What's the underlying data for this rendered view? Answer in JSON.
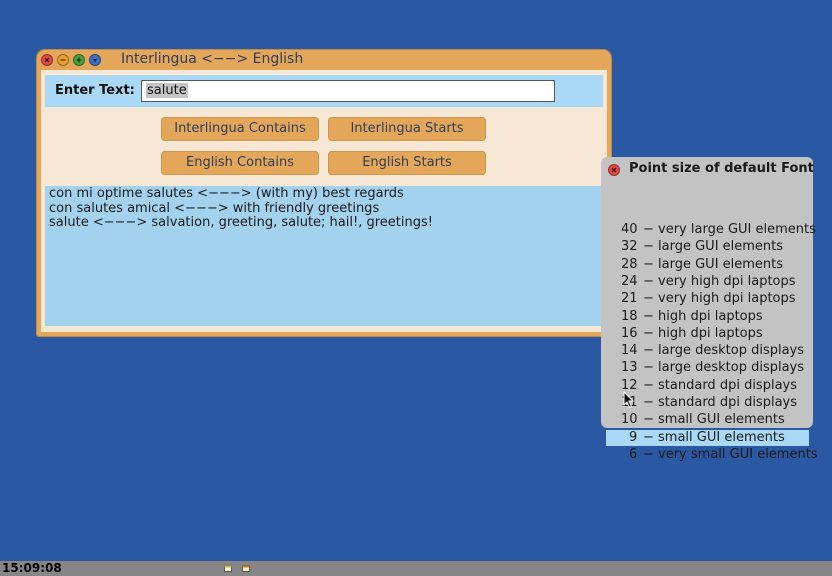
{
  "window": {
    "title": "Interlingua <−−> English",
    "controls": [
      "close",
      "minimize",
      "maximize",
      "menu"
    ],
    "entry_label": "Enter Text:",
    "entry_value": "salute",
    "buttons": {
      "interlingua_contains": "Interlingua Contains",
      "interlingua_starts": "Interlingua Starts",
      "english_contains": "English Contains",
      "english_starts": "English Starts"
    },
    "results": [
      "con mi optime salutes <−−−> (with my) best regards",
      "con salutes amical <−−−> with friendly greetings",
      "salute <−−−> salvation, greeting, salute; hail!, greetings!"
    ]
  },
  "font_menu": {
    "title": "Point size of default Font",
    "selected_index": 12,
    "items": [
      {
        "size": "40",
        "label": "− very large GUI elements"
      },
      {
        "size": "32",
        "label": "− large GUI elements"
      },
      {
        "size": "28",
        "label": "− large GUI elements"
      },
      {
        "size": "24",
        "label": "− very high dpi laptops"
      },
      {
        "size": "21",
        "label": "− very high dpi laptops"
      },
      {
        "size": "18",
        "label": "− high dpi laptops"
      },
      {
        "size": "16",
        "label": "− high dpi laptops"
      },
      {
        "size": "14",
        "label": "− large desktop displays"
      },
      {
        "size": "13",
        "label": "− large desktop displays"
      },
      {
        "size": "12",
        "label": "− standard dpi displays"
      },
      {
        "size": "11",
        "label": "− standard dpi displays"
      },
      {
        "size": "10",
        "label": "− small GUI elements"
      },
      {
        "size": "9",
        "label": "− small GUI elements"
      },
      {
        "size": "6",
        "label": "− very small GUI elements"
      }
    ]
  },
  "taskbar": {
    "clock": "15:09:08",
    "icons": [
      "window-icon",
      "window-icon"
    ]
  },
  "colors": {
    "desktop": "#2a58a2",
    "window_frame": "#e4a75a",
    "client_bg": "#f6e8d4",
    "highlight": "#a9d9f7",
    "results_bg": "#a3d2ef",
    "menu_bg": "#c3c3c3",
    "taskbar": "#868686"
  }
}
